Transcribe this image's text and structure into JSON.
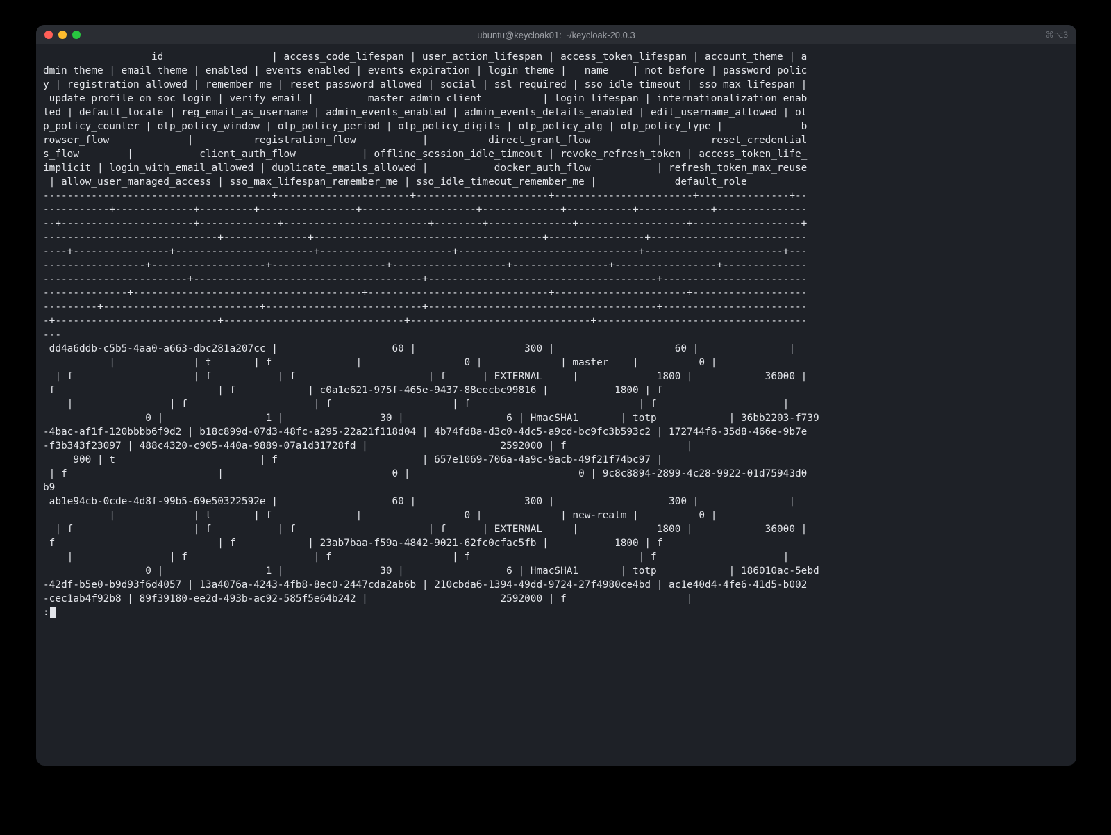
{
  "window": {
    "title": "ubuntu@keycloak01: ~/keycloak-20.0.3",
    "tabhint": "⌘⌥3"
  },
  "columns": [
    "id",
    "access_code_lifespan",
    "user_action_lifespan",
    "access_token_lifespan",
    "account_theme",
    "admin_theme",
    "email_theme",
    "enabled",
    "events_enabled",
    "events_expiration",
    "login_theme",
    "name",
    "not_before",
    "password_policy",
    "registration_allowed",
    "remember_me",
    "reset_password_allowed",
    "social",
    "ssl_required",
    "sso_idle_timeout",
    "sso_max_lifespan",
    "update_profile_on_soc_login",
    "verify_email",
    "master_admin_client",
    "login_lifespan",
    "internationalization_enabled",
    "default_locale",
    "reg_email_as_username",
    "admin_events_enabled",
    "admin_events_details_enabled",
    "edit_username_allowed",
    "otp_policy_counter",
    "otp_policy_window",
    "otp_policy_period",
    "otp_policy_digits",
    "otp_policy_alg",
    "otp_policy_type",
    "browser_flow",
    "registration_flow",
    "direct_grant_flow",
    "reset_credentials_flow",
    "client_auth_flow",
    "offline_session_idle_timeout",
    "revoke_refresh_token",
    "access_token_life_implicit",
    "login_with_email_allowed",
    "duplicate_emails_allowed",
    "docker_auth_flow",
    "refresh_token_max_reuse",
    "allow_user_managed_access",
    "sso_max_lifespan_remember_me",
    "sso_idle_timeout_remember_me",
    "default_role"
  ],
  "rows": [
    {
      "id": "dd4a6ddb-c5b5-4aa0-a663-dbc281a207cc",
      "access_code_lifespan": 60,
      "user_action_lifespan": 300,
      "access_token_lifespan": 60,
      "account_theme": "",
      "admin_theme": "",
      "email_theme": "",
      "enabled": "t",
      "events_enabled": "f",
      "events_expiration": 0,
      "login_theme": "",
      "name": "master",
      "not_before": 0,
      "password_policy": "",
      "registration_allowed": "f",
      "remember_me": "f",
      "reset_password_allowed": "f",
      "social": "f",
      "ssl_required": "EXTERNAL",
      "sso_idle_timeout": 1800,
      "sso_max_lifespan": 36000,
      "update_profile_on_soc_login": "f",
      "verify_email": "f",
      "master_admin_client": "c0a1e621-975f-465e-9437-88eecbc99816",
      "login_lifespan": 1800,
      "internationalization_enabled": "f",
      "default_locale": "",
      "reg_email_as_username": "f",
      "admin_events_enabled": "f",
      "admin_events_details_enabled": "f",
      "edit_username_allowed": "f",
      "otp_policy_counter": 0,
      "otp_policy_window": 1,
      "otp_policy_period": 30,
      "otp_policy_digits": 6,
      "otp_policy_alg": "HmacSHA1",
      "otp_policy_type": "totp",
      "browser_flow": "36bb2203-f739-4bac-af1f-120bbbb6f9d2",
      "registration_flow": "b18c899d-07d3-48fc-a295-22a21f118d04",
      "direct_grant_flow": "4b74fd8a-d3c0-4dc5-a9cd-bc9fc3b593c2",
      "reset_credentials_flow": "172744f6-35d8-466e-9b7e-f3b343f23097",
      "client_auth_flow": "488c4320-c905-440a-9889-07a1d31728fd",
      "offline_session_idle_timeout": 2592000,
      "revoke_refresh_token": "f",
      "access_token_life_implicit": 900,
      "login_with_email_allowed": "t",
      "duplicate_emails_allowed": "f",
      "docker_auth_flow": "657e1069-706a-4a9c-9acb-49f21f74bc97",
      "refresh_token_max_reuse": "",
      "allow_user_managed_access": "f",
      "sso_max_lifespan_remember_me": 0,
      "sso_idle_timeout_remember_me": 0,
      "default_role": "9c8c8894-2899-4c28-9922-01d75943d0b9"
    },
    {
      "id": "ab1e94cb-0cde-4d8f-99b5-69e50322592e",
      "access_code_lifespan": 60,
      "user_action_lifespan": 300,
      "access_token_lifespan": 300,
      "account_theme": "",
      "admin_theme": "",
      "email_theme": "",
      "enabled": "t",
      "events_enabled": "f",
      "events_expiration": 0,
      "login_theme": "",
      "name": "new-realm",
      "not_before": 0,
      "password_policy": "",
      "registration_allowed": "f",
      "remember_me": "f",
      "reset_password_allowed": "f",
      "social": "f",
      "ssl_required": "EXTERNAL",
      "sso_idle_timeout": 1800,
      "sso_max_lifespan": 36000,
      "update_profile_on_soc_login": "f",
      "verify_email": "f",
      "master_admin_client": "23ab7baa-f59a-4842-9021-62fc0cfac5fb",
      "login_lifespan": 1800,
      "internationalization_enabled": "f",
      "default_locale": "",
      "reg_email_as_username": "f",
      "admin_events_enabled": "f",
      "admin_events_details_enabled": "f",
      "edit_username_allowed": "f",
      "otp_policy_counter": 0,
      "otp_policy_window": 1,
      "otp_policy_period": 30,
      "otp_policy_digits": 6,
      "otp_policy_alg": "HmacSHA1",
      "otp_policy_type": "totp",
      "browser_flow": "186010ac-5ebd-42df-b5e0-b9d93f6d4057",
      "registration_flow": "13a4076a-4243-4fb8-8ec0-2447cda2ab6b",
      "direct_grant_flow": "210cbda6-1394-49dd-9724-27f4980ce4bd",
      "reset_credentials_flow": "ac1e40d4-4fe6-41d5-b002-cec1ab4f92b8",
      "client_auth_flow": "89f39180-ee2d-493b-ac92-585f5e64b242",
      "offline_session_idle_timeout": 2592000,
      "revoke_refresh_token": "f",
      "access_token_life_implicit": "",
      "login_with_email_allowed": "",
      "duplicate_emails_allowed": "",
      "docker_auth_flow": "",
      "refresh_token_max_reuse": "",
      "allow_user_managed_access": "",
      "sso_max_lifespan_remember_me": "",
      "sso_idle_timeout_remember_me": "",
      "default_role": ""
    }
  ],
  "prompt": ":",
  "lines": [
    "                  id                  | access_code_lifespan | user_action_lifespan | access_token_lifespan | account_theme | a",
    "dmin_theme | email_theme | enabled | events_enabled | events_expiration | login_theme |   name    | not_before | password_polic",
    "y | registration_allowed | remember_me | reset_password_allowed | social | ssl_required | sso_idle_timeout | sso_max_lifespan |",
    " update_profile_on_soc_login | verify_email |         master_admin_client          | login_lifespan | internationalization_enab",
    "led | default_locale | reg_email_as_username | admin_events_enabled | admin_events_details_enabled | edit_username_allowed | ot",
    "p_policy_counter | otp_policy_window | otp_policy_period | otp_policy_digits | otp_policy_alg | otp_policy_type |             b",
    "rowser_flow             |          registration_flow           |          direct_grant_flow           |        reset_credential",
    "s_flow        |           client_auth_flow           | offline_session_idle_timeout | revoke_refresh_token | access_token_life_",
    "implicit | login_with_email_allowed | duplicate_emails_allowed |           docker_auth_flow           | refresh_token_max_reuse",
    " | allow_user_managed_access | sso_max_lifespan_remember_me | sso_idle_timeout_remember_me |             default_role",
    "--------------------------------------+----------------------+----------------------+-----------------------+---------------+--",
    "-----------+-------------+---------+----------------+-------------------+-------------+-----------+------------+---------------",
    "--+----------------------+-------------+------------------------+--------+--------------+------------------+------------------+",
    "-----------------------------+--------------+--------------------------------------+----------------+--------------------------",
    "----+----------------+-----------------------+----------------------+------------------------------+-----------------------+---",
    "-----------------+-------------------+-------------------+-------------------+----------------+-----------------+--------------",
    "------------------------+--------------------------------------+--------------------------------------+------------------------",
    "--------------+--------------------------------------+------------------------------+----------------------+-------------------",
    "---------+--------------------------+--------------------------+--------------------------------------+------------------------",
    "-+---------------------------+------------------------------+------------------------------+-----------------------------------",
    "---",
    " dd4a6ddb-c5b5-4aa0-a663-dbc281a207cc |                   60 |                  300 |                    60 |               |",
    "           |             | t       | f              |                 0 |             | master    |          0 |",
    "  | f                    | f           | f                      | f      | EXTERNAL     |             1800 |            36000 |",
    " f                           | f            | c0a1e621-975f-465e-9437-88eecbc99816 |           1800 | f",
    "    |                | f                     | f                    | f                            | f                     |",
    "                 0 |                 1 |                30 |                 6 | HmacSHA1       | totp            | 36bb2203-f739",
    "-4bac-af1f-120bbbb6f9d2 | b18c899d-07d3-48fc-a295-22a21f118d04 | 4b74fd8a-d3c0-4dc5-a9cd-bc9fc3b593c2 | 172744f6-35d8-466e-9b7e",
    "-f3b343f23097 | 488c4320-c905-440a-9889-07a1d31728fd |                      2592000 | f                    |",
    "     900 | t                        | f                        | 657e1069-706a-4a9c-9acb-49f21f74bc97 |",
    " | f                         |                            0 |                            0 | 9c8c8894-2899-4c28-9922-01d75943d0",
    "b9",
    " ab1e94cb-0cde-4d8f-99b5-69e50322592e |                   60 |                  300 |                   300 |               |",
    "           |             | t       | f              |                 0 |             | new-realm |          0 |",
    "  | f                    | f           | f                      | f      | EXTERNAL     |             1800 |            36000 |",
    " f                           | f            | 23ab7baa-f59a-4842-9021-62fc0cfac5fb |           1800 | f",
    "    |                | f                     | f                    | f                            | f                     |",
    "                 0 |                 1 |                30 |                 6 | HmacSHA1       | totp            | 186010ac-5ebd",
    "-42df-b5e0-b9d93f6d4057 | 13a4076a-4243-4fb8-8ec0-2447cda2ab6b | 210cbda6-1394-49dd-9724-27f4980ce4bd | ac1e40d4-4fe6-41d5-b002",
    "-cec1ab4f92b8 | 89f39180-ee2d-493b-ac92-585f5e64b242 |                      2592000 | f                    |"
  ]
}
